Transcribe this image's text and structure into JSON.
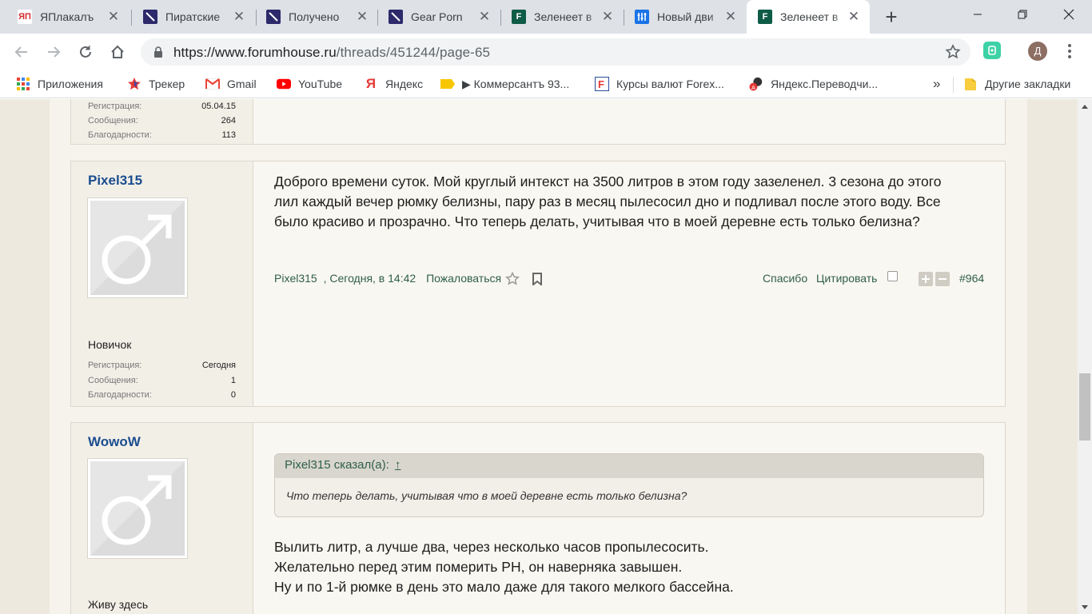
{
  "browser": {
    "tabs": [
      {
        "title": "ЯПлакалъ",
        "favicon": "yaplakal-icon",
        "color": "#e53935",
        "glyph": "ЯП"
      },
      {
        "title": "Пиратские",
        "favicon": "slash-icon",
        "color": "#2c2a6b",
        "glyph": "╲"
      },
      {
        "title": "Получено",
        "favicon": "slash-icon",
        "color": "#2c2a6b",
        "glyph": "╲"
      },
      {
        "title": "Gear Porn",
        "favicon": "slash-icon",
        "color": "#2c2a6b",
        "glyph": "╲"
      },
      {
        "title": "Зеленеет в",
        "favicon": "forumhouse-icon",
        "color": "#0f5c46",
        "glyph": "F"
      },
      {
        "title": "Новый дви",
        "favicon": "equalizer-icon",
        "color": "#1a73e8",
        "glyph": "♯"
      },
      {
        "title": "Зеленеет в",
        "favicon": "forumhouse-icon",
        "color": "#0f5c46",
        "glyph": "F"
      }
    ],
    "new_tab_label": "+",
    "url_host": "https://www.forumhouse.ru",
    "url_path": "/threads/451244/page-65",
    "profile_initial": "Д"
  },
  "bookmarks": [
    {
      "label": "Приложения",
      "icon": "apps-grid-icon"
    },
    {
      "label": "Трекер",
      "icon": "tracker-star-icon"
    },
    {
      "label": "Gmail",
      "icon": "gmail-icon"
    },
    {
      "label": "YouTube",
      "icon": "youtube-icon"
    },
    {
      "label": "Яндекс",
      "icon": "yandex-icon"
    },
    {
      "label": "▶ Коммерсантъ 93...",
      "icon": "kommersant-icon"
    },
    {
      "label": "Курсы валют Forex...",
      "icon": "forex-icon"
    },
    {
      "label": "Яндекс.Переводчи...",
      "icon": "translate-icon"
    }
  ],
  "bookmarks_overflow": "»",
  "other_bookmarks": "Другие закладки",
  "top_post_stats": [
    {
      "key": "Регистрация:",
      "value": "05.04.15"
    },
    {
      "key": "Сообщения:",
      "value": "264"
    },
    {
      "key": "Благодарности:",
      "value": "113"
    }
  ],
  "post1": {
    "username": "Pixel315",
    "rank": "Новичок",
    "stats": [
      {
        "key": "Регистрация:",
        "value": "Сегодня"
      },
      {
        "key": "Сообщения:",
        "value": "1"
      },
      {
        "key": "Благодарности:",
        "value": "0"
      }
    ],
    "text_lines": [
      "Доброго времени суток. Мой круглый интекст на 3500 литров в этом году зазеленел. 3 сезона до этого",
      "лил каждый вечер рюмку белизны, пару раз в месяц пылесосил дно и подливал после этого воду. Все",
      "было красиво и прозрачно. Что теперь делать, учитывая что в моей деревне есть только белизна?"
    ],
    "meta_author": "Pixel315",
    "meta_time": ", Сегодня, в 14:42",
    "report": "Пожаловаться",
    "thanks": "Спасибо",
    "quote_btn": "Цитировать",
    "post_number": "#964"
  },
  "post2": {
    "username": "WowoW",
    "rank": "Живу здесь",
    "quote_header": "Pixel315 сказал(а):",
    "quote_arrow": "↑",
    "quote_text": "Что теперь делать, учитывая что в моей деревне есть только белизна?",
    "text_lines": [
      "Вылить литр, а лучше два, через несколько часов пропылесосить.",
      "Желательно перед этим померить PH, он наверняка завышен.",
      "Ну и по 1-й рюмке в день это мало даже для такого мелкого бассейна."
    ]
  }
}
